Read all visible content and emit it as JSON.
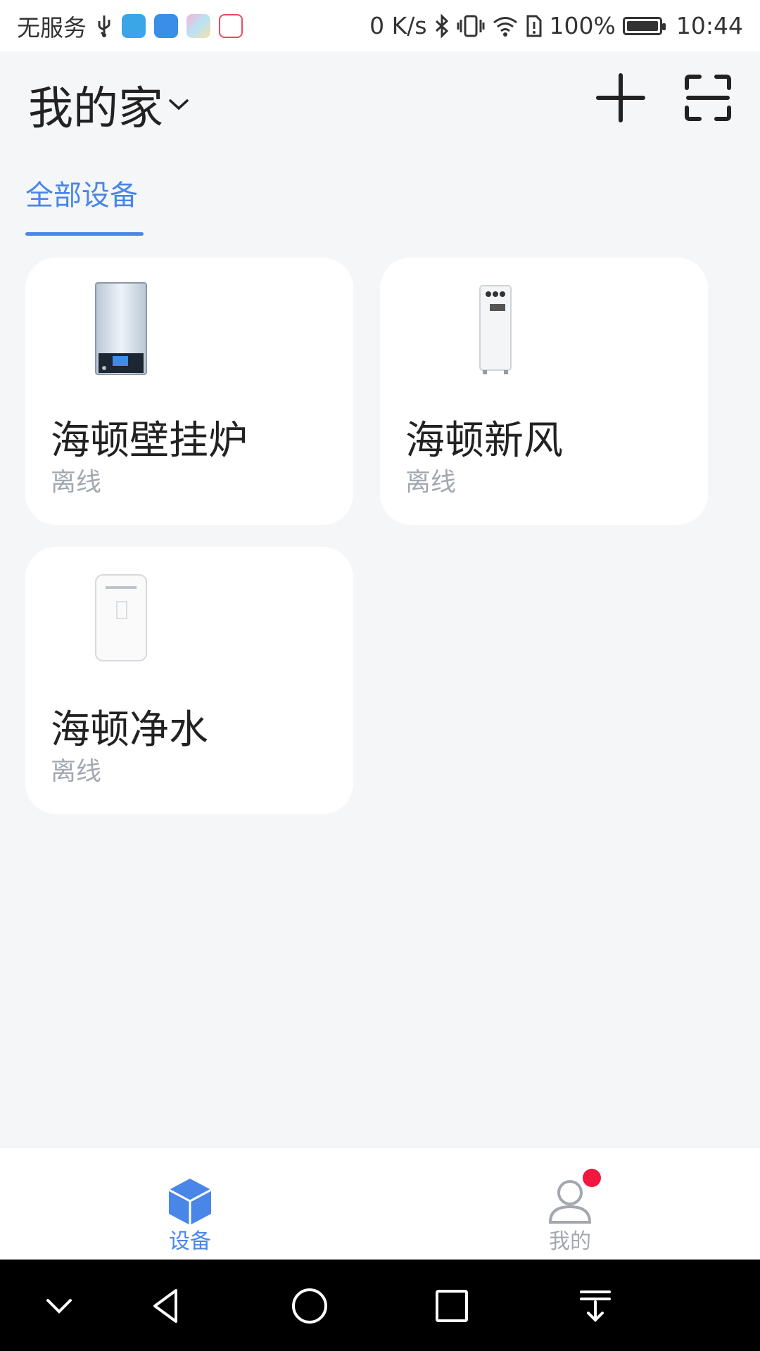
{
  "status_bar": {
    "carrier": "无服务",
    "network_speed": "0 K/s",
    "battery": "100%",
    "time": "10:44",
    "icons": [
      "usb-icon",
      "cloud-app-icon",
      "shield-app-icon",
      "photos-app-icon",
      "map-app-icon",
      "bluetooth-icon",
      "vibrate-icon",
      "wifi-icon",
      "sim-alert-icon",
      "battery-icon"
    ]
  },
  "header": {
    "title": "我的家",
    "add_icon": "plus-icon",
    "scan_icon": "scan-icon"
  },
  "tabs": [
    {
      "label": "全部设备",
      "active": true
    }
  ],
  "devices": [
    {
      "name": "海顿壁挂炉",
      "status": "离线",
      "icon": "wall-boiler-image"
    },
    {
      "name": "海顿新风",
      "status": "离线",
      "icon": "fresh-air-unit-image"
    },
    {
      "name": "海顿净水",
      "status": "离线",
      "icon": "water-purifier-image"
    }
  ],
  "bottom_nav": [
    {
      "label": "设备",
      "icon": "cube-icon",
      "active": true,
      "color": "#4a86e8"
    },
    {
      "label": "我的",
      "icon": "profile-icon",
      "active": false,
      "color": "#a3a8b0",
      "badge": true
    }
  ],
  "colors": {
    "accent": "#4a86e8",
    "badge": "#f0183f",
    "muted": "#a3a8b0"
  }
}
